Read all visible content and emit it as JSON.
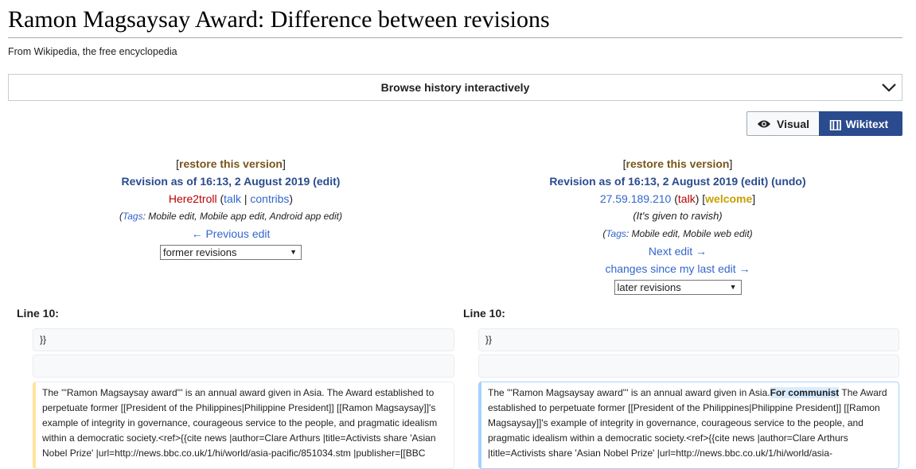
{
  "page": {
    "title": "Ramon Magsaysay Award: Difference between revisions",
    "tagline": "From Wikipedia, the free encyclopedia"
  },
  "browse": {
    "label": "Browse history interactively"
  },
  "toggle": {
    "visual": "Visual",
    "wikitext": "Wikitext",
    "wikitext_icon": "[[]]"
  },
  "left": {
    "restore": "restore this version",
    "revision": "Revision as of 16:13, 2 August 2019",
    "edit": "edit",
    "user": "Here2troll",
    "talk": "talk",
    "contribs": "contribs",
    "tags_label": "Tags",
    "tags": ": Mobile edit, Mobile app edit, Android app edit)",
    "nav": "← Previous edit",
    "select": "former revisions"
  },
  "right": {
    "restore": "restore this version",
    "revision": "Revision as of 16:13, 2 August 2019",
    "edit": "edit",
    "undo": "undo",
    "user": "27.59.189.210",
    "talk": "talk",
    "welcome": "welcome",
    "summary": "(It's given to ravish)",
    "tags_label": "Tags",
    "tags": ": Mobile edit, Mobile web edit)",
    "nav": "Next edit →",
    "since": "changes since my last edit →",
    "select": "later revisions"
  },
  "diff": {
    "left_line": "Line 10:",
    "right_line": "Line 10:",
    "ctx1": "}}",
    "ctx2": "",
    "del_text": "The '''Ramon Magsaysay award'''  is an annual award given in Asia. The Award established to perpetuate former [[President of the Philippines|Philippine President]] [[Ramon Magsaysay]]'s example of integrity in governance, courageous service to the people, and pragmatic idealism within a democratic society.<ref>{{cite news |author=Clare Arthurs |title=Activists share 'Asian Nobel Prize' |url=http://news.bbc.co.uk/1/hi/world/asia-pacific/851034.stm |publisher=[[BBC",
    "ins_before": "The '''Ramon Magsaysay award'''  is an annual award given in Asia.",
    "ins_added": "For communist",
    "ins_after": " The Award established to perpetuate former [[President of the Philippines|Philippine President]] [[Ramon Magsaysay]]'s example of integrity in governance, courageous service to the people, and pragmatic idealism within a democratic society.<ref>{{cite news |author=Clare Arthurs |title=Activists share 'Asian Nobel Prize' |url=http://news.bbc.co.uk/1/hi/world/asia-"
  }
}
